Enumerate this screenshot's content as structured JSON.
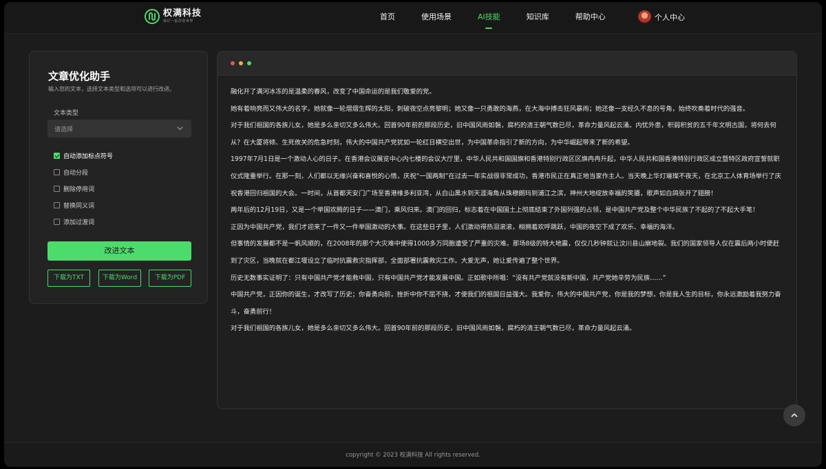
{
  "brand": {
    "name": "权满科技",
    "slogan": "我们一起改变世界",
    "accent": "#4cdc6c"
  },
  "nav": {
    "items": [
      {
        "label": "首页"
      },
      {
        "label": "使用场景"
      },
      {
        "label": "AI技能",
        "active": true
      },
      {
        "label": "知识库"
      },
      {
        "label": "帮助中心"
      }
    ],
    "user_label": "个人中心"
  },
  "panel": {
    "title": "文章优化助手",
    "subtitle": "输入您的文本，选择文本类型和选项可以进行改进。",
    "type_label": "文本类型",
    "select_placeholder": "请选择",
    "options": [
      {
        "label": "自动添加标点符号",
        "checked": true
      },
      {
        "label": "自动分段",
        "checked": false
      },
      {
        "label": "删除停用词",
        "checked": false
      },
      {
        "label": "替换同义词",
        "checked": false
      },
      {
        "label": "添加过渡词",
        "checked": false
      }
    ],
    "improve_label": "改进文本",
    "downloads": [
      "下载为TXT",
      "下载为Word",
      "下载为PDF"
    ]
  },
  "editor": {
    "window_dots": [
      "#e05a4f",
      "#e3b341",
      "#4cdc6c"
    ],
    "paragraphs": [
      "融化开了满河冰冻的是温柔的春风，改变了中国命运的是我们敬爱的党。",
      "她有着响亮而又伟大的名字。她就像一轮熠熠生辉的太阳，刺破夜空点亮黎明；她又像一只勇敢的海燕，在大海中搏击狂风暴雨；她还像一支经久不息的号角，始终吹奏着时代的强音。",
      "对于我们祖国的各族儿女，她是多么亲切又多么伟大。回首90年前的那段历史，旧中国风雨如磐，腐朽的清王朝气数已尽，革命力量风起云涌。内忧外患，积弱积贫的五千年文明古国，将何去何从？在大厦将倾、生死攸关的危急时刻，伟大的中国共产党犹如一轮红日横空出世，为中国革命指引了新的方向，为中华崛起带来了新的希望。",
      "1997年7月1日是一个激动人心的日子。在香港会议展览中心内七楼的会议大厅里，中华人民共和国国旗和香港特别行政区区旗冉冉升起，中华人民共和国香港特别行政区成立暨特区政府宣誓就职仪式隆重举行。在那一刻，人们都以无缘兴奋和喜悦的心情，庆祝“一国两制”在过去一年实战很非常成功，香港市民正在真正地当家作主人。当天晚上华灯璀璨不夜天，在北京工人体育场举行了庆祝香港回归祖国的大会。一时间，从首都天安门广场至香港维多利亚湾，从白山黑水到天涯海角从珠穆朗玛到浦江之滨，神州大地绽放幸福的笑靥，歌声如白鸽张开了翅膀！",
      "两年后的12月19日，又是一个举国欢腾的日子——澳门，乘风归来。澳门的回归，标志着在中国国土上彻底结束了外国列强的占领，是中国共产党及整个中华民族了不起的了不起大手笔！",
      "正因为中国共产党，我们才迎来了一件又一件举国激动的大事。在这些日子里，人们激动得热泪滚滚，相拥着欢呼跳跃，中国的夜空下成了欢乐、幸福的海洋。",
      "但事情的发展都不是一帆风顺的，在2008年的那个大灾难中使得1000多万同胞遭受了严重的灾难。那场8级的特大地震，仅仅几秒钟就让汶川县山崩地裂。我们的国家领导人仅在震后两小时便赶到了灾区，当晚就在都江堰设立了临时抗震救灾指挥部，全面部署抗震救灾工作。大爱无声，她让爱传遍了整个世界。",
      "历史无数事实证明了：只有中国共产党才能救中国，只有中国共产党才能发展中国。正如歌中所唱：“没有共产党就没有新中国，共产党她辛劳为民族……”",
      "中国共产党，正因你的诞生，才改写了历史；你奋勇向前，挫折中你不屈不挠，才使我们的祖国日益强大。我爱你，伟大的中国共产党，你是我的梦想，你是我人生的目标，你永远激励着我努力奋斗，奋勇前行！",
      "对于我们祖国的各族儿女，她是多么亲切又多么伟大。回首90年前的那段历史，旧中国风雨如磐，腐朽的清王朝气数已尽，革命力量风起云涌。"
    ]
  },
  "footer": {
    "copyright": "copyright © 2023 权满科技 All rights reserved."
  },
  "icons": {
    "logo": "logo-mark-icon",
    "select": "chevron-down-icon",
    "back_to_top": "chevron-up-icon"
  }
}
